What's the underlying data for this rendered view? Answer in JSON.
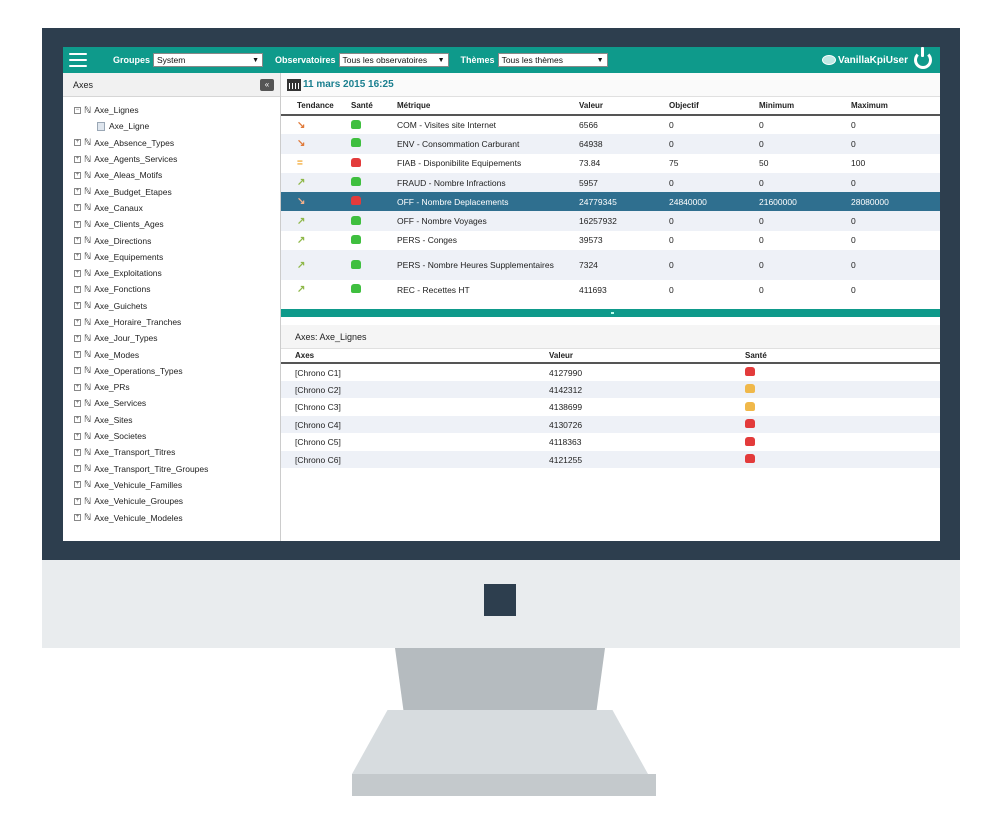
{
  "topbar": {
    "groupes_label": "Groupes",
    "groupes_value": "System",
    "observatoires_label": "Observatoires",
    "observatoires_value": "Tous les observatoires",
    "themes_label": "Thèmes",
    "themes_value": "Tous les thèmes",
    "user_name": "VanillaKpiUser"
  },
  "sidebar": {
    "title": "Axes",
    "items": [
      {
        "label": "Axe_Lignes",
        "expander": "−"
      },
      {
        "label": "Axe_Ligne",
        "child": true
      },
      {
        "label": "Axe_Absence_Types",
        "expander": "+"
      },
      {
        "label": "Axe_Agents_Services",
        "expander": "+"
      },
      {
        "label": "Axe_Aleas_Motifs",
        "expander": "+"
      },
      {
        "label": "Axe_Budget_Etapes",
        "expander": "+"
      },
      {
        "label": "Axe_Canaux",
        "expander": "+"
      },
      {
        "label": "Axe_Clients_Ages",
        "expander": "+"
      },
      {
        "label": "Axe_Directions",
        "expander": "+"
      },
      {
        "label": "Axe_Equipements",
        "expander": "+"
      },
      {
        "label": "Axe_Exploitations",
        "expander": "+"
      },
      {
        "label": "Axe_Fonctions",
        "expander": "+"
      },
      {
        "label": "Axe_Guichets",
        "expander": "+"
      },
      {
        "label": "Axe_Horaire_Tranches",
        "expander": "+"
      },
      {
        "label": "Axe_Jour_Types",
        "expander": "+"
      },
      {
        "label": "Axe_Modes",
        "expander": "+"
      },
      {
        "label": "Axe_Operations_Types",
        "expander": "+"
      },
      {
        "label": "Axe_PRs",
        "expander": "+"
      },
      {
        "label": "Axe_Services",
        "expander": "+"
      },
      {
        "label": "Axe_Sites",
        "expander": "+"
      },
      {
        "label": "Axe_Societes",
        "expander": "+"
      },
      {
        "label": "Axe_Transport_Titres",
        "expander": "+"
      },
      {
        "label": "Axe_Transport_Titre_Groupes",
        "expander": "+"
      },
      {
        "label": "Axe_Vehicule_Familles",
        "expander": "+"
      },
      {
        "label": "Axe_Vehicule_Groupes",
        "expander": "+"
      },
      {
        "label": "Axe_Vehicule_Modeles",
        "expander": "+"
      }
    ]
  },
  "main": {
    "date": "11 mars 2015 16:25",
    "kpi_table": {
      "headers": {
        "tendance": "Tendance",
        "sante": "Santé",
        "metrique": "Métrique",
        "valeur": "Valeur",
        "objectif": "Objectif",
        "minimum": "Minimum",
        "maximum": "Maximum"
      },
      "rows": [
        {
          "trend": "down",
          "trend_glyph": "↘",
          "health": "good",
          "metric": "COM - Visites site Internet",
          "valeur": "6566",
          "objectif": "0",
          "minimum": "0",
          "maximum": "0"
        },
        {
          "trend": "down",
          "trend_glyph": "↘",
          "health": "good",
          "metric": "ENV - Consommation Carburant",
          "valeur": "64938",
          "objectif": "0",
          "minimum": "0",
          "maximum": "0"
        },
        {
          "trend": "eq",
          "trend_glyph": "=",
          "health": "bad",
          "metric": "FIAB - Disponibilite Equipements",
          "valeur": "73.84",
          "objectif": "75",
          "minimum": "50",
          "maximum": "100"
        },
        {
          "trend": "up",
          "trend_glyph": "↗",
          "health": "good",
          "metric": "FRAUD - Nombre Infractions",
          "valeur": "5957",
          "objectif": "0",
          "minimum": "0",
          "maximum": "0"
        },
        {
          "trend": "down",
          "trend_glyph": "↘",
          "health": "bad",
          "metric": "OFF - Nombre Deplacements",
          "valeur": "24779345",
          "objectif": "24840000",
          "minimum": "21600000",
          "maximum": "28080000",
          "selected": true
        },
        {
          "trend": "up",
          "trend_glyph": "↗",
          "health": "good",
          "metric": "OFF - Nombre Voyages",
          "valeur": "16257932",
          "objectif": "0",
          "minimum": "0",
          "maximum": "0"
        },
        {
          "trend": "up",
          "trend_glyph": "↗",
          "health": "good",
          "metric": "PERS - Conges",
          "valeur": "39573",
          "objectif": "0",
          "minimum": "0",
          "maximum": "0"
        },
        {
          "trend": "up",
          "trend_glyph": "↗",
          "health": "good",
          "metric": "PERS - Nombre Heures Supplementaires",
          "valeur": "7324",
          "objectif": "0",
          "minimum": "0",
          "maximum": "0",
          "tall": true
        },
        {
          "trend": "up",
          "trend_glyph": "↗",
          "health": "good",
          "metric": "REC - Recettes HT",
          "valeur": "411693",
          "objectif": "0",
          "minimum": "0",
          "maximum": "0"
        }
      ]
    },
    "axes_panel": {
      "title": "Axes: Axe_Lignes",
      "headers": {
        "axes": "Axes",
        "valeur": "Valeur",
        "sante": "Santé"
      },
      "rows": [
        {
          "axe": "[Chrono C1]",
          "valeur": "4127990",
          "health": "bad"
        },
        {
          "axe": "[Chrono C2]",
          "valeur": "4142312",
          "health": "neutral"
        },
        {
          "axe": "[Chrono C3]",
          "valeur": "4138699",
          "health": "neutral"
        },
        {
          "axe": "[Chrono C4]",
          "valeur": "4130726",
          "health": "bad"
        },
        {
          "axe": "[Chrono C5]",
          "valeur": "4118363",
          "health": "bad"
        },
        {
          "axe": "[Chrono C6]",
          "valeur": "4121255",
          "health": "bad"
        }
      ]
    }
  },
  "colors": {
    "accent": "#0e9a8b",
    "selected_row": "#2f6f8f",
    "bezel": "#2d3e4e"
  }
}
